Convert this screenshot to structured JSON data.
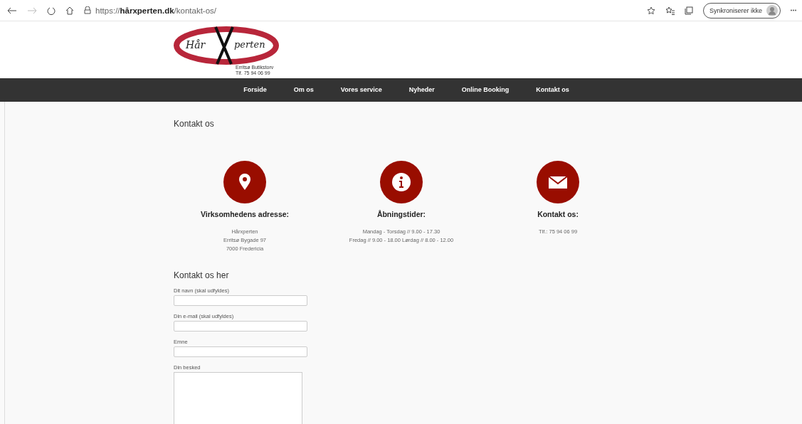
{
  "browser": {
    "url": "https://**hårxperten.dk**/kontakt-os/",
    "sync_button": "Synkroniserer ikke"
  },
  "logo": {
    "word_left": "Hår",
    "word_right": "perten",
    "line_1": "Erritsø Butikstorv",
    "line_2": "Tlf. 75 94 06 99"
  },
  "nav": [
    {
      "label": "Forside"
    },
    {
      "label": "Om os"
    },
    {
      "label": "Vores service"
    },
    {
      "label": "Nyheder"
    },
    {
      "label": "Online Booking"
    },
    {
      "label": "Kontakt os"
    }
  ],
  "page_title": "Kontakt os",
  "info_columns": [
    {
      "kind": "pin",
      "heading": "Virksomhedens adresse:",
      "lines": [
        "Hårxperten",
        "Erritsø Bygade 97",
        "7000 Fredericia"
      ]
    },
    {
      "kind": "info",
      "heading": "Åbningstider:",
      "lines": [
        "Mandag - Torsdag // 9.00 - 17.30",
        "Fredag // 9.00 - 18.00 Lørdag // 8.00 - 12.00"
      ]
    },
    {
      "kind": "mail",
      "heading": "Kontakt os:",
      "lines": [
        "Tlf.: 75 94 06 99"
      ]
    }
  ],
  "form": {
    "title": "Kontakt os her",
    "fields": [
      {
        "kind": "input",
        "label": "Dit navn (skal udfyldes)"
      },
      {
        "kind": "input",
        "label": "Din e-mail (skal udfyldes)"
      },
      {
        "kind": "input",
        "label": "Emne"
      },
      {
        "kind": "textarea",
        "label": "Din besked"
      }
    ]
  }
}
